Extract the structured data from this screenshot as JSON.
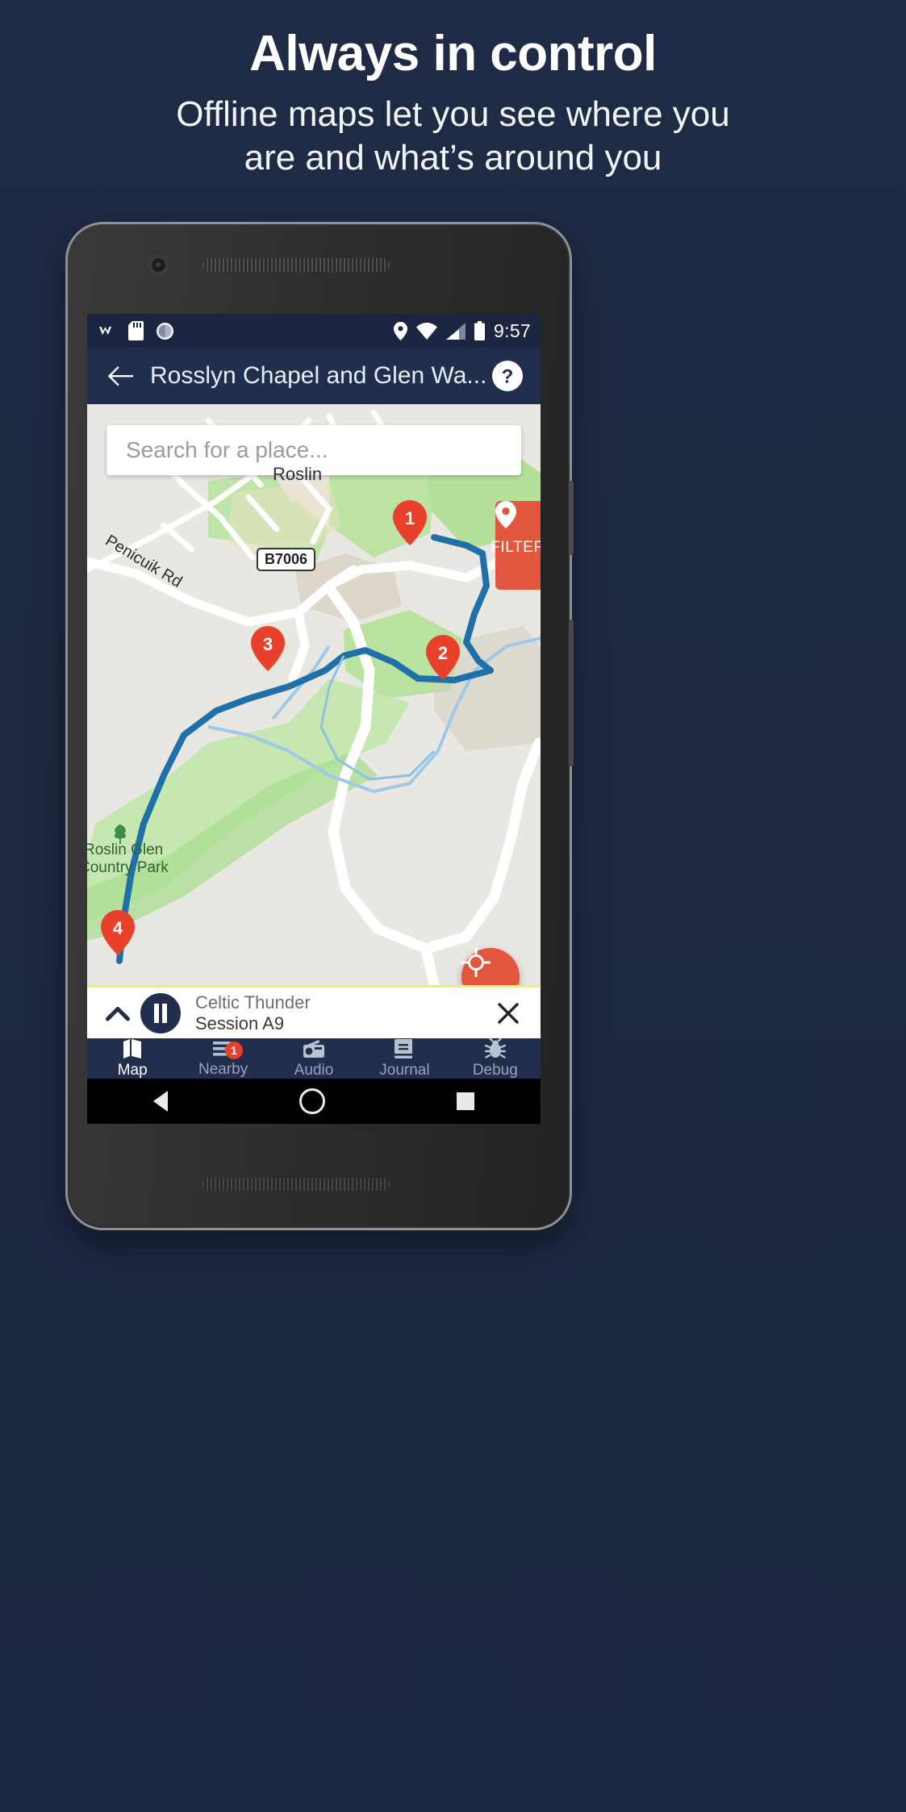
{
  "promo": {
    "title": "Always in control",
    "subtitle_line1": "Offline maps let you see where you",
    "subtitle_line2": "are and what’s around you"
  },
  "colors": {
    "background": "#1f2a45",
    "appbar": "#222e4e",
    "statusbar": "#1b2440",
    "accent": "#e0573e",
    "badge": "#e8402a",
    "map_background": "#e9e7e2",
    "player_top_border": "#eef06a"
  },
  "statusbar": {
    "left_icons": [
      "weather-icon",
      "sd-card-icon",
      "sync-icon"
    ],
    "right_icons": [
      "location-pin-icon",
      "wifi-icon",
      "signal-icon",
      "battery-icon"
    ],
    "time": "9:57"
  },
  "appbar": {
    "back_icon": "arrow-left-icon",
    "title": "Rosslyn Chapel and Glen Wa...",
    "help_icon": "help-circle-icon"
  },
  "search": {
    "placeholder": "Search for a place...",
    "value": ""
  },
  "filter": {
    "icon": "map-pin-icon",
    "label": "FILTER"
  },
  "locate": {
    "icon": "crosshair-gps-icon"
  },
  "map": {
    "labels": [
      {
        "text": "Roslin",
        "kind": "place"
      },
      {
        "text": "Penicuik Rd",
        "kind": "road"
      },
      {
        "text": "B7006",
        "kind": "shield"
      },
      {
        "text": "Roslin Glen",
        "kind": "park"
      },
      {
        "text": "Country Park",
        "kind": "park"
      }
    ],
    "markers": [
      {
        "label": "1"
      },
      {
        "label": "2"
      },
      {
        "label": "3"
      },
      {
        "label": "4"
      }
    ]
  },
  "player": {
    "expand_icon": "chevron-up-icon",
    "play_icon": "pause-icon",
    "title": "Celtic Thunder",
    "subtitle": "Session A9",
    "close_icon": "close-icon"
  },
  "bottom_nav": {
    "items": [
      {
        "label": "Map",
        "icon": "map-icon",
        "active": true,
        "badge": ""
      },
      {
        "label": "Nearby",
        "icon": "list-icon",
        "active": false,
        "badge": "1"
      },
      {
        "label": "Audio",
        "icon": "radio-icon",
        "active": false,
        "badge": ""
      },
      {
        "label": "Journal",
        "icon": "book-icon",
        "active": false,
        "badge": ""
      },
      {
        "label": "Debug",
        "icon": "bug-icon",
        "active": false,
        "badge": ""
      }
    ]
  },
  "android_nav": {
    "back": "back-triangle-icon",
    "home": "home-circle-icon",
    "recents": "recents-square-icon"
  }
}
